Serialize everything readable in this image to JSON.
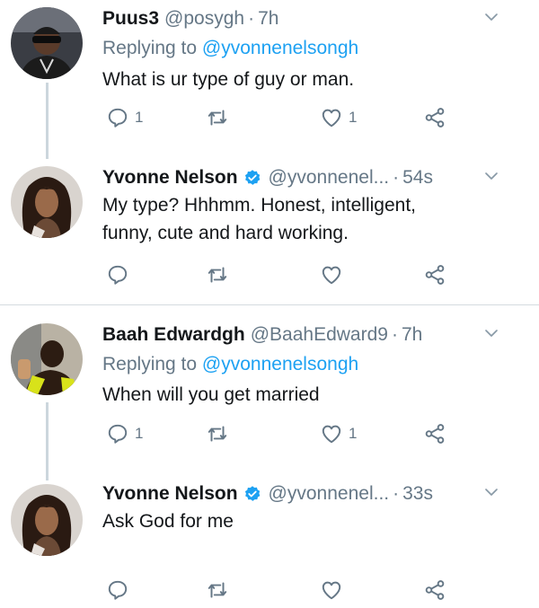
{
  "tweets": [
    {
      "name": "Puus3",
      "handle": "@posygh",
      "separator": "·",
      "time": "7h",
      "replying_prefix": "Replying to ",
      "replying_to": "@yvonnenelsongh",
      "text": "What is ur type of guy or man.",
      "replies": "1",
      "likes": "1"
    },
    {
      "name": "Yvonne Nelson",
      "handle": "@yvonnenel...",
      "separator": "·",
      "time": "54s",
      "text_line1": "My type? Hhhmm. Honest, intelligent,",
      "text_line2": "funny, cute and hard working."
    },
    {
      "name": "Baah Edwardgh",
      "handle": "@BaahEdward9",
      "separator": "·",
      "time": "7h",
      "replying_prefix": "Replying to ",
      "replying_to": "@yvonnenelsongh",
      "text": "When will you get married",
      "replies": "1",
      "likes": "1"
    },
    {
      "name": "Yvonne Nelson",
      "handle": "@yvonnenel...",
      "separator": "·",
      "time": "33s",
      "text": "Ask God for me"
    }
  ],
  "icons": {
    "reply": "reply-icon",
    "retweet": "retweet-icon",
    "like": "heart-icon",
    "share": "share-icon",
    "more": "chevron-down-icon",
    "verified": "verified-badge-icon"
  },
  "colors": {
    "link": "#1da1f2",
    "muted": "#657786",
    "icon": "#657786",
    "verified": "#1da1f2",
    "connector": "#ccd6dd"
  }
}
